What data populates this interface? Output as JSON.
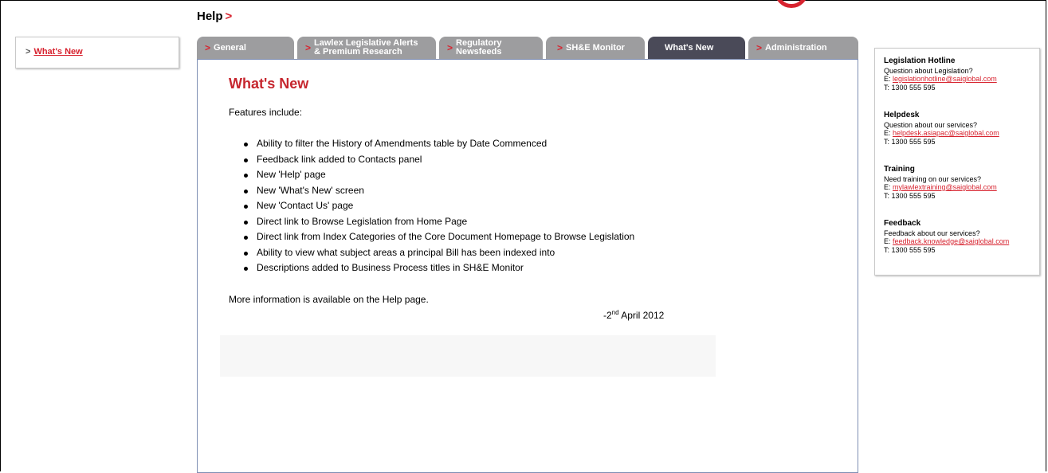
{
  "header": {
    "title": "Help",
    "title_arrow": ">"
  },
  "sidebar": {
    "items": [
      {
        "chevron": ">",
        "label": "What's New"
      }
    ]
  },
  "tabs": [
    {
      "arrow": ">",
      "label": "General"
    },
    {
      "arrow": ">",
      "label": "Lawlex Legislative Alerts\n& Premium Research"
    },
    {
      "arrow": ">",
      "label": "Regulatory\nNewsfeeds"
    },
    {
      "arrow": ">",
      "label": "SH&E Monitor"
    },
    {
      "arrow": ">",
      "label": "What's New",
      "active": true
    },
    {
      "arrow": ">",
      "label": "Administration"
    }
  ],
  "main": {
    "title": "What's New",
    "intro": "Features include:",
    "features": [
      "Ability to filter the History of Amendments table by Date Commenced",
      "Feedback link added to Contacts panel",
      "New 'Help' page",
      "New 'What's New' screen",
      "New 'Contact Us' page",
      "Direct link to Browse Legislation from Home Page",
      "Direct link from Index Categories of the Core Document Homepage to Browse Legislation",
      "Ability to view what subject areas a principal Bill has been indexed into",
      "Descriptions added to Business Process titles in SH&E Monitor"
    ],
    "more_info": "More information is available on the Help page.",
    "date_prefix": "-2",
    "date_suffix": "nd",
    "date_rest": " April 2012"
  },
  "contacts": [
    {
      "title": "Legislation Hotline",
      "question": "Question about Legislation?",
      "email_prefix": "E: ",
      "email": "legislationhotline@saiglobal.com",
      "phone": "T: 1300 555 595"
    },
    {
      "title": "Helpdesk",
      "question": "Question about our services?",
      "email_prefix": "E: ",
      "email": "helpdesk.asiapac@saiglobal.com",
      "phone": "T: 1300 555 595"
    },
    {
      "title": "Training",
      "question": "Need training on our services?",
      "email_prefix": "E: ",
      "email": "mylawlextraining@saiglobal.com",
      "phone": "T: 1300 555 595"
    },
    {
      "title": "Feedback",
      "question": "Feedback about our services?",
      "email_prefix": "E: ",
      "email": "feedback.knowledge@saiglobal.com",
      "phone": "T: 1300 555 595"
    }
  ],
  "colors": {
    "accent": "#d7232f",
    "heading": "#c6262e",
    "tab_inactive": "#9d9d9f",
    "tab_active": "#4a4a58",
    "content_border": "#7f8fb4"
  },
  "icons": {
    "logo": "brand-logo-ring",
    "tab_arrow": "chevron-right-icon"
  }
}
